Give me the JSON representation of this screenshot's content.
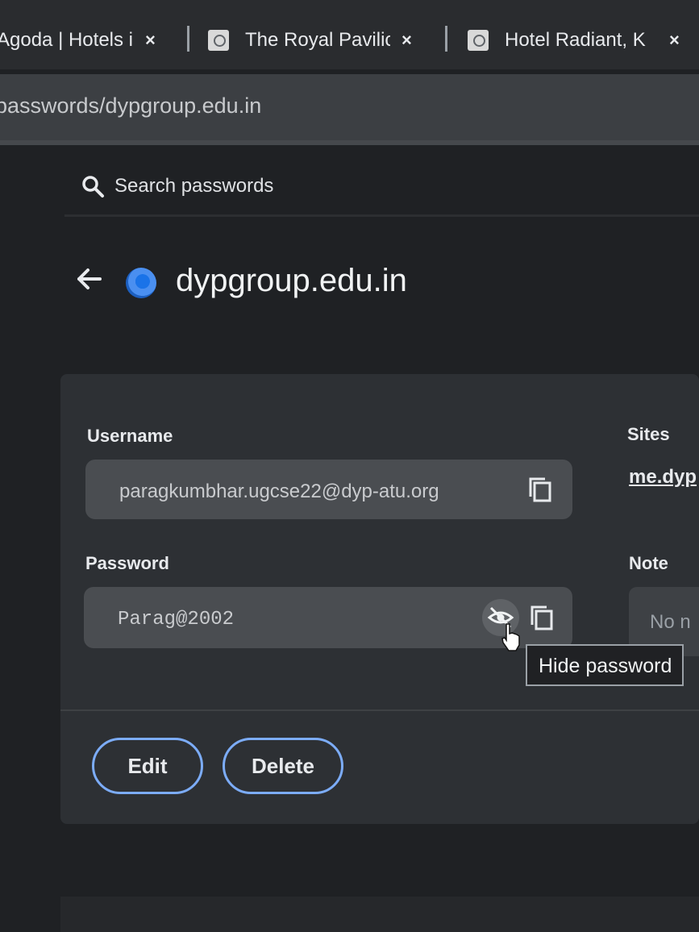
{
  "tabs": [
    {
      "title": "Agoda | Hotels i",
      "close": "×"
    },
    {
      "title": "The Royal Pavilic",
      "close": "×"
    },
    {
      "title": "Hotel Radiant, K",
      "close": "×"
    }
  ],
  "address_bar": {
    "url": "passwords/dypgroup.edu.in"
  },
  "search": {
    "placeholder": "Search passwords"
  },
  "detail": {
    "site_title": "dypgroup.edu.in",
    "username": {
      "label": "Username",
      "value": "paragkumbhar.ugcse22@dyp-atu.org"
    },
    "password": {
      "label": "Password",
      "value": "Parag@2002"
    },
    "sites": {
      "label": "Sites",
      "link": "me.dyp"
    },
    "note": {
      "label": "Note",
      "value": "No n"
    },
    "edit_label": "Edit",
    "delete_label": "Delete",
    "tooltip": "Hide password"
  },
  "colors": {
    "accent": "#7cacf8",
    "background": "#1f2124",
    "card": "#2d3034",
    "field": "#4a4d51"
  },
  "icons": [
    "search-icon",
    "back-arrow-icon",
    "site-favicon-icon",
    "copy-icon",
    "hide-password-icon",
    "pointer-cursor-icon"
  ]
}
